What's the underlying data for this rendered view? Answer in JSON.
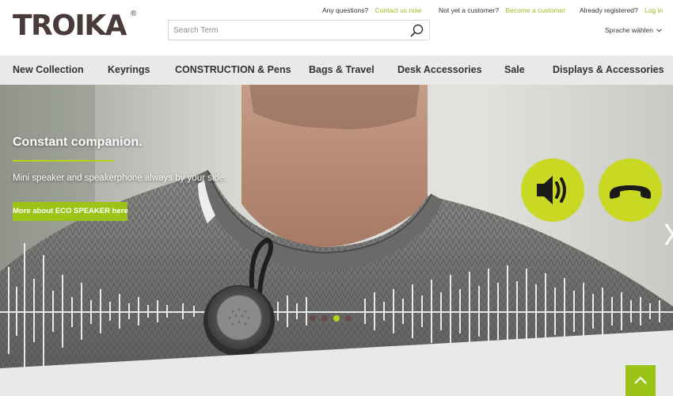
{
  "brand": {
    "logo_text": "TROIKA",
    "registered_mark": "®"
  },
  "topbar": {
    "questions_text": "Any questions?",
    "contact_link": "Contact us now",
    "not_customer_text": "Not yet a customer?",
    "become_customer_link": "Become a customer",
    "registered_text": "Already registered?",
    "login_link": "Log in"
  },
  "search": {
    "placeholder": "Search Term",
    "value": ""
  },
  "language": {
    "label": "Sprache wählen"
  },
  "nav": {
    "items": [
      {
        "label": "New Collection"
      },
      {
        "label": "Keyrings"
      },
      {
        "label": "CONSTRUCTION & Pens"
      },
      {
        "label": "Bags & Travel"
      },
      {
        "label": "Desk Accessories"
      },
      {
        "label": "Sale"
      },
      {
        "label": "Displays & Accessories"
      }
    ]
  },
  "hero": {
    "title": "Constant companion.",
    "subtitle": "Mini speaker and speakerphone always by your side.",
    "cta_label": "More about ECO SPEAKER here",
    "slides_count": 4,
    "active_slide": 3
  },
  "icons": {
    "search": "search-icon",
    "lang_chevron": "chevron-down-icon",
    "speaker": "speaker-volume-icon",
    "phone": "phone-hangup-icon",
    "next": "chevron-right-icon",
    "scroll_top": "chevron-up-icon"
  },
  "colors": {
    "accent_green": "#9cc418",
    "badge_green": "#c9d923",
    "logo_brown": "#4a3b3b",
    "nav_bg": "#e9e9e9"
  }
}
